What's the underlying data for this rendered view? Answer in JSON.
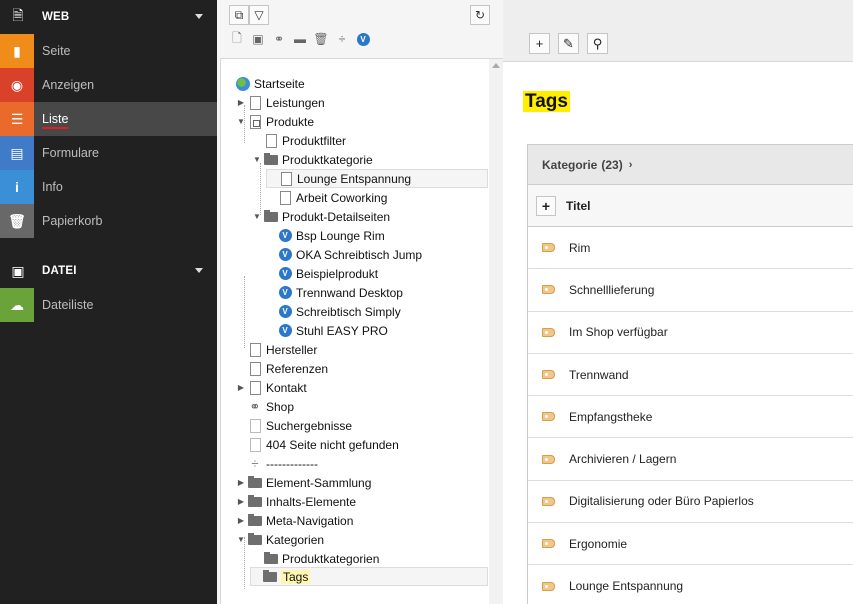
{
  "modules": {
    "web": {
      "title": "WEB",
      "items": [
        {
          "label": "Seite",
          "icon": "page-module-icon",
          "color": "#f08c1a"
        },
        {
          "label": "Anzeigen",
          "icon": "eye-icon",
          "color": "#d9412b"
        },
        {
          "label": "Liste",
          "icon": "list-icon",
          "color": "#e96a2a"
        },
        {
          "label": "Formulare",
          "icon": "form-icon",
          "color": "#3f7bc6"
        },
        {
          "label": "Info",
          "icon": "info-icon",
          "color": "#3a8fd6"
        },
        {
          "label": "Papierkorb",
          "icon": "trash-icon",
          "color": "#686868"
        }
      ]
    },
    "datei": {
      "title": "DATEI",
      "items": [
        {
          "label": "Dateiliste",
          "icon": "filelist-icon",
          "color": "#6aa339"
        }
      ]
    }
  },
  "tree": {
    "nodes": [
      {
        "label": "Startseite",
        "type": "root"
      },
      {
        "label": "Leistungen",
        "type": "page"
      },
      {
        "label": "Produkte",
        "type": "subpage"
      },
      {
        "label": "Produktfilter",
        "type": "page"
      },
      {
        "label": "Produktkategorie",
        "type": "folder"
      },
      {
        "label": "Lounge Entspannung",
        "type": "page"
      },
      {
        "label": "Arbeit Coworking",
        "type": "page"
      },
      {
        "label": "Produkt-Detailseiten",
        "type": "folder"
      },
      {
        "label": "Bsp Lounge Rim",
        "type": "product"
      },
      {
        "label": "OKA Schreibtisch Jump",
        "type": "product"
      },
      {
        "label": "Beispielprodukt",
        "type": "product"
      },
      {
        "label": "Trennwand Desktop",
        "type": "product"
      },
      {
        "label": "Schreibtisch Simply",
        "type": "product"
      },
      {
        "label": "Stuhl EASY PRO",
        "type": "product"
      },
      {
        "label": "Hersteller",
        "type": "page"
      },
      {
        "label": "Referenzen",
        "type": "page"
      },
      {
        "label": "Kontakt",
        "type": "page"
      },
      {
        "label": "Shop",
        "type": "link"
      },
      {
        "label": "Suchergebnisse",
        "type": "hidden"
      },
      {
        "label": "404 Seite nicht gefunden",
        "type": "hidden"
      },
      {
        "label": "-------------",
        "type": "divider"
      },
      {
        "label": "Element-Sammlung",
        "type": "folder"
      },
      {
        "label": "Inhalts-Elemente",
        "type": "folder"
      },
      {
        "label": "Meta-Navigation",
        "type": "folder"
      },
      {
        "label": "Kategorien",
        "type": "folder"
      },
      {
        "label": "Produktkategorien",
        "type": "folder"
      },
      {
        "label": "Tags",
        "type": "folder"
      }
    ]
  },
  "content": {
    "title": "Tags",
    "table": {
      "header": "Kategorie",
      "count": "(23)",
      "chevron": "›",
      "column": "Titel",
      "rows": [
        "Rim",
        "Schnelllieferung",
        "Im Shop verfügbar",
        "Trennwand",
        "Empfangstheke",
        "Archivieren / Lagern",
        "Digitalisierung oder Büro Papierlos",
        "Ergonomie",
        "Lounge Entspannung"
      ]
    }
  },
  "colors": {
    "highlight": "#ffee00",
    "module_bg": "#212121",
    "active_underline": "#e02020"
  }
}
